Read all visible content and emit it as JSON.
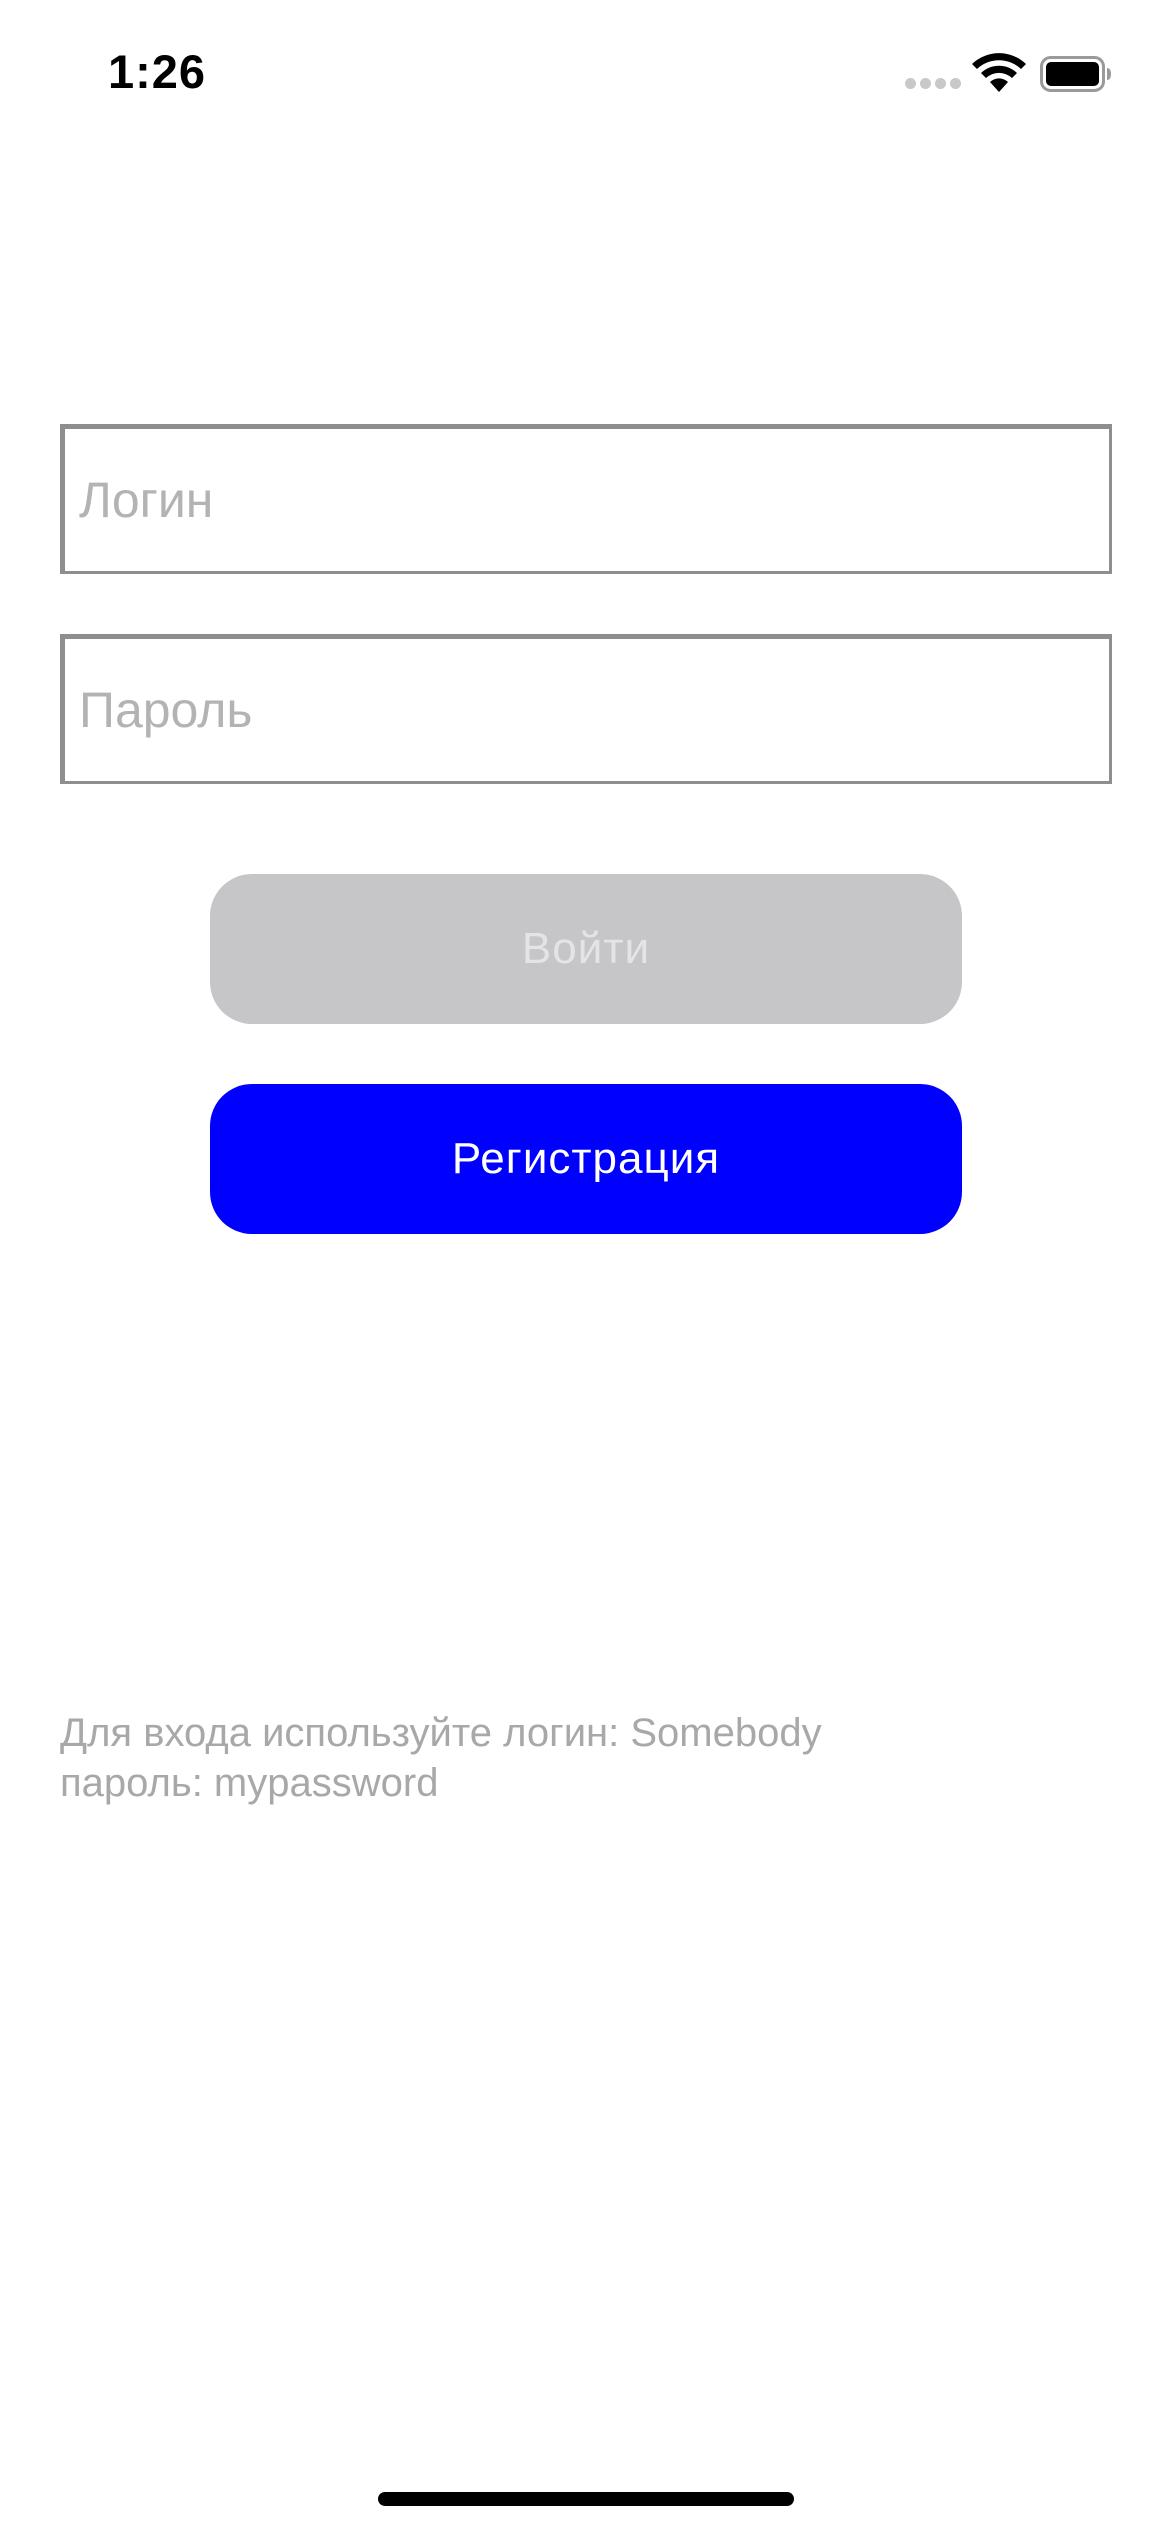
{
  "status_bar": {
    "time": "1:26",
    "icons": [
      "cellular-signal-icon",
      "wifi-icon",
      "battery-icon"
    ]
  },
  "form": {
    "login_placeholder": "Логин",
    "login_value": "",
    "password_placeholder": "Пароль",
    "password_value": "",
    "login_button_label": "Войти",
    "register_button_label": "Регистрация"
  },
  "hint": {
    "line1": "Для входа используйте логин: Somebody",
    "line2": "пароль: mypassword"
  },
  "colors": {
    "accent": "#0000ff",
    "disabled_button": "#c6c6c8",
    "disabled_text": "#e4e4e6",
    "placeholder": "#b3b3b3",
    "hint_text": "#a8a8a8",
    "field_border": "#8e8e8e"
  }
}
